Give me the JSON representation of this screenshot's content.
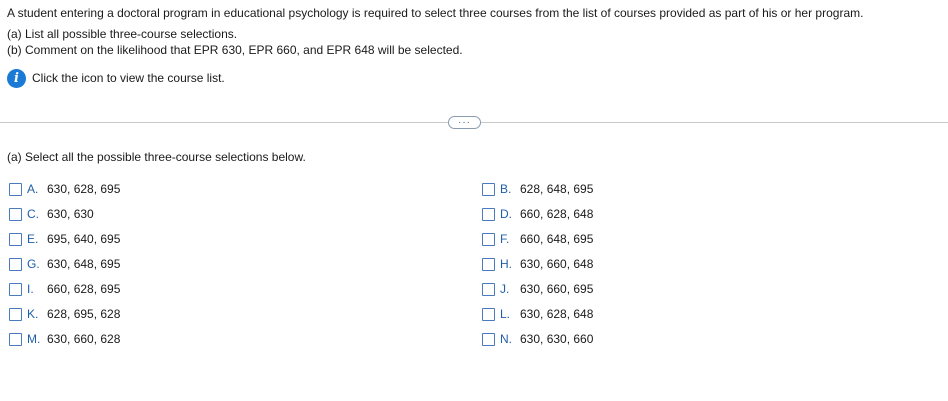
{
  "question": {
    "line1": "A student entering a doctoral program in educational psychology is required to select three courses from the list of courses provided as part of his or her program.",
    "line2": "(a) List all possible three-course selections.",
    "line3": "(b) Comment on the likelihood that EPR 630, EPR 660, and EPR 648 will be selected.",
    "info_text": "Click the icon to view the course list.",
    "info_icon": "i"
  },
  "divider": {
    "expand_label": "···"
  },
  "part_a": {
    "prompt": "(a) Select all the possible three-course selections below.",
    "options": [
      {
        "letter": "A.",
        "value": "630, 628, 695"
      },
      {
        "letter": "B.",
        "value": "628, 648, 695"
      },
      {
        "letter": "C.",
        "value": "630, 630"
      },
      {
        "letter": "D.",
        "value": "660, 628, 648"
      },
      {
        "letter": "E.",
        "value": "695, 640, 695"
      },
      {
        "letter": "F.",
        "value": "660, 648, 695"
      },
      {
        "letter": "G.",
        "value": "630, 648, 695"
      },
      {
        "letter": "H.",
        "value": "630, 660, 648"
      },
      {
        "letter": "I.",
        "value": "660, 628, 695"
      },
      {
        "letter": "J.",
        "value": "630, 660, 695"
      },
      {
        "letter": "K.",
        "value": "628, 695, 628"
      },
      {
        "letter": "L.",
        "value": "630, 628, 648"
      },
      {
        "letter": "M.",
        "value": "630, 660, 628"
      },
      {
        "letter": "N.",
        "value": "630, 630, 660"
      }
    ]
  },
  "colors": {
    "accent": "#1f5fa8",
    "info_icon": "#1a7ad6",
    "checkbox_border": "#4a7bbf"
  }
}
